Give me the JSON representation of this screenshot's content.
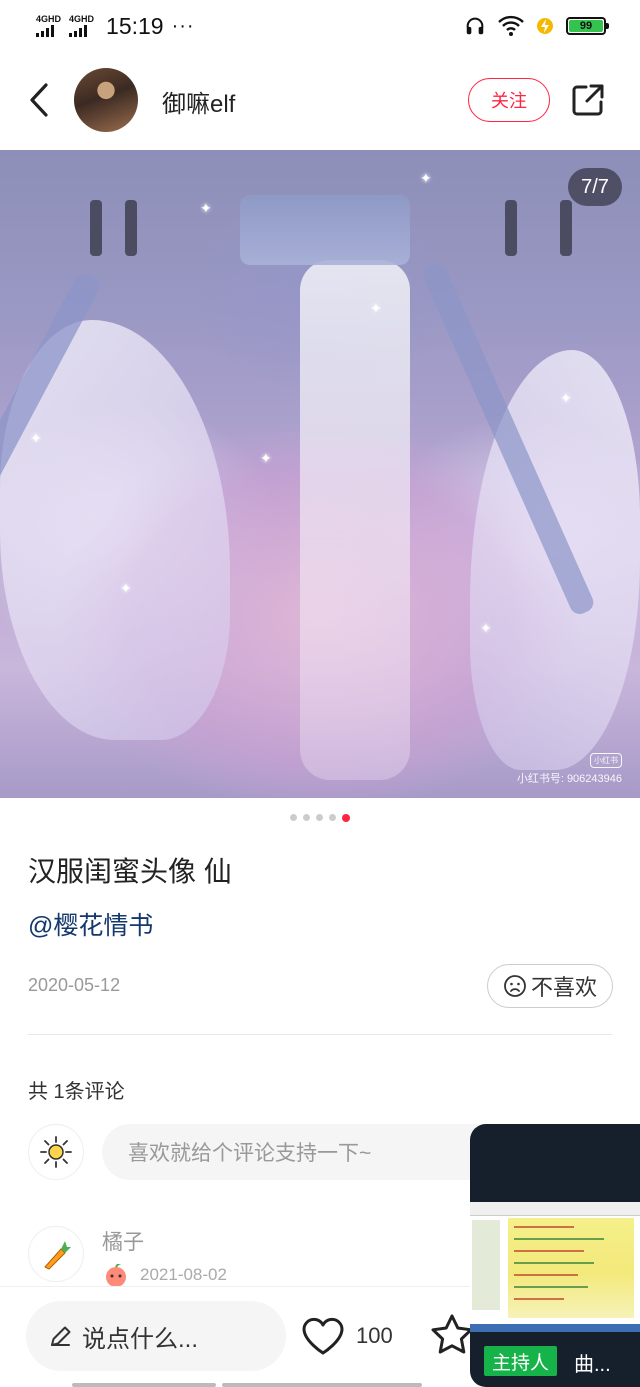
{
  "status_bar": {
    "network1": "4GHD",
    "network2": "4GHD",
    "time": "15:19",
    "more": "···",
    "battery": "99"
  },
  "header": {
    "author_name": "御嘛elf",
    "follow_label": "关注"
  },
  "image": {
    "page_counter": "7/7",
    "watermark_logo": "小红书",
    "watermark_text": "小红书号: 906243946",
    "page_count": 5,
    "active_index": 4
  },
  "note": {
    "title": "汉服闺蜜头像 仙",
    "mention": "@樱花情书",
    "date": "2020-05-12",
    "dislike_label": "不喜欢"
  },
  "comments": {
    "count_label": "共 1条评论",
    "input_placeholder": "喜欢就给个评论支持一下~",
    "items": [
      {
        "name": "橘子",
        "date": "2021-08-02"
      }
    ]
  },
  "bottom_bar": {
    "say_placeholder": "说点什么...",
    "like_count": "100"
  },
  "floating_window": {
    "host_tag": "主持人",
    "host_name": "曲..."
  },
  "colors": {
    "brand": "#ff2442",
    "mention": "#13386c",
    "host_tag": "#16b24a"
  }
}
